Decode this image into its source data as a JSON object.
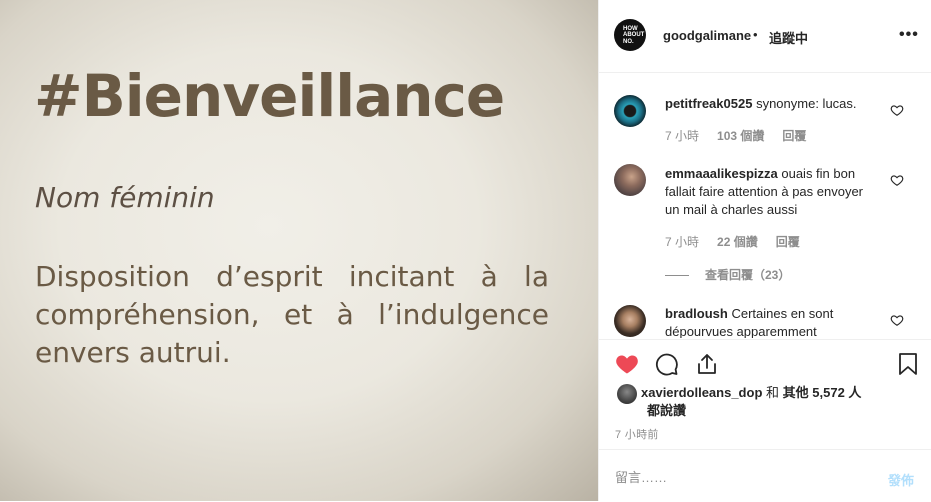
{
  "image": {
    "hashtag": "#Bienveillance",
    "subtitle": "Nom féminin",
    "definition": "Disposition d’esprit incitant à la compréhension, et à l’indulgence envers autrui."
  },
  "header": {
    "avatar_text": "HOW ABOUT NO.",
    "username": "goodgalimane",
    "separator": "•",
    "follow_status": "追蹤中",
    "more_icon": "more-horizontal-icon"
  },
  "comments": [
    {
      "username": "petitfreak0525",
      "text": "synonyme: lucas.",
      "time": "7 小時",
      "likes": "103 個讚",
      "reply": "回覆"
    },
    {
      "username": "emmaaalikespizza",
      "text": "ouais fin bon fallait faire attention à pas envoyer un mail à charles aussi",
      "time": "7 小時",
      "likes": "22 個讚",
      "reply": "回覆",
      "view_replies": "查看回覆（23）"
    },
    {
      "username": "bradloush",
      "text": "Certaines en sont dépourvues apparemment"
    }
  ],
  "actions": {
    "like_icon": "heart-filled-icon",
    "comment_icon": "comment-icon",
    "share_icon": "share-icon",
    "save_icon": "bookmark-icon",
    "like_color": "#ed4956"
  },
  "likes": {
    "user": "xavierdolleans_dop",
    "conjunction": "和",
    "others": "其他 5,572 人",
    "suffix": "都說讚"
  },
  "timestamp": "7 小時前",
  "comment_box": {
    "placeholder": "留言……",
    "post_label": "發佈"
  },
  "colors": {
    "accent_blue_disabled": "#b2dffc",
    "text_primary": "#262626",
    "text_secondary": "#8e8e8e",
    "image_text": "#6a5a45"
  }
}
